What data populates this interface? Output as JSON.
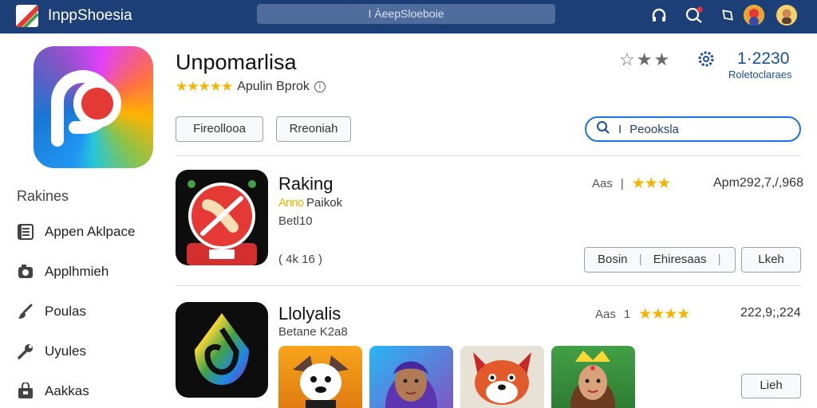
{
  "topbar": {
    "app_name": "InppShoesia",
    "search_placeholder": "I ÀeepSloeboie"
  },
  "sidebar": {
    "title": "Rakines",
    "items": [
      {
        "label": "Appen Aklpace",
        "icon": "list-icon"
      },
      {
        "label": "Applhmieh",
        "icon": "camera-icon"
      },
      {
        "label": "Poulas",
        "icon": "brush-icon"
      },
      {
        "label": "Uyules",
        "icon": "wrench-icon"
      },
      {
        "label": "Aakkas",
        "icon": "bag-icon"
      }
    ]
  },
  "header": {
    "title": "Unpomarlisa",
    "developer": "Apulin Bprok",
    "stars": "★★★★★",
    "rating_stars": "☆★★",
    "count": "1·2230",
    "count_label": "Roletoclaraes",
    "buttons": [
      "Fireollooa",
      "Rreoniah"
    ],
    "search_prefix": "I",
    "search_placeholder": "Peooksla"
  },
  "rows": [
    {
      "name": "Raking",
      "dev_prefix": "Anno",
      "dev_name": "Paikok",
      "sub": "Betl10",
      "extra": "( 4k 16 )",
      "meta_label": "Aas",
      "stars": "★★★",
      "value": "Apm292,7,/,968",
      "btn_a": "Bosin",
      "btn_b": "Ehiresaas",
      "btn_c": "Lkeh"
    },
    {
      "name": "Llolyalis",
      "sub": "Betane K2a8",
      "meta_label": "Aas",
      "stars": "★★★★",
      "value": "222,9;,224",
      "btn_c": "Lieh"
    }
  ],
  "colors": {
    "topbar": "#1d3f78",
    "accent": "#1a73e8",
    "star": "#f4b400"
  }
}
